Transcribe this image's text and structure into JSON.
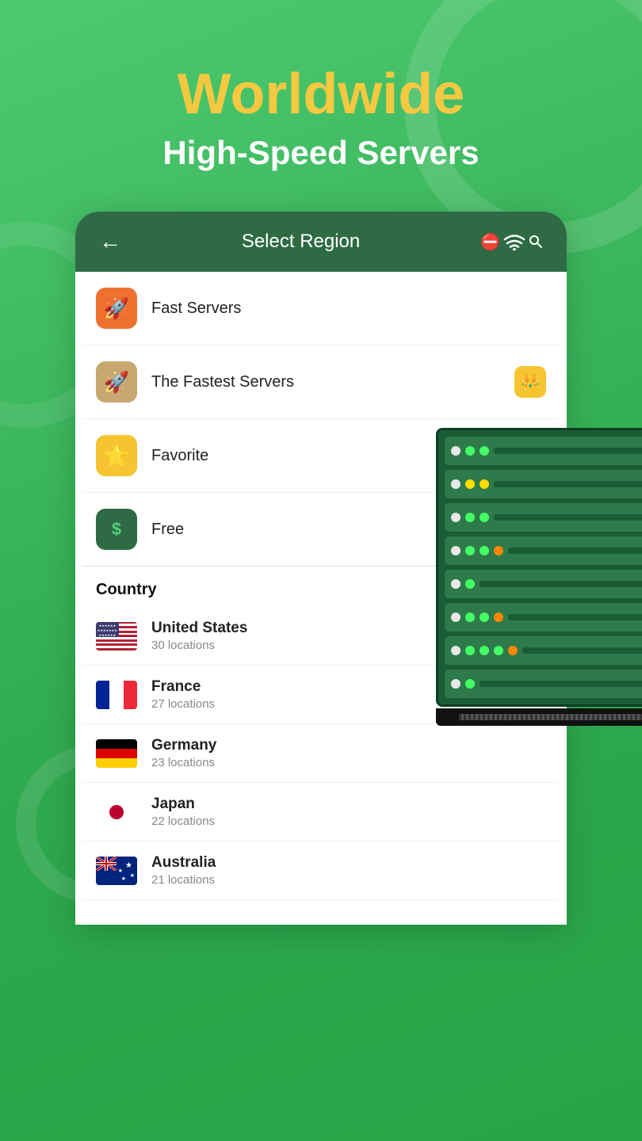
{
  "header": {
    "title_line1": "Worldwide",
    "title_line2": "High-Speed Servers"
  },
  "card": {
    "back_arrow": "←",
    "title": "Select Region",
    "wifi_icon": "📡"
  },
  "menu_items": [
    {
      "id": "fast-servers",
      "label": "Fast Servers",
      "icon": "🚀",
      "icon_bg": "orange",
      "right": ""
    },
    {
      "id": "fastest-servers",
      "label": "The Fastest Servers",
      "icon": "🚀",
      "icon_bg": "tan",
      "right": "crown"
    },
    {
      "id": "favorite",
      "label": "Favorite",
      "icon": "⭐",
      "icon_bg": "yellow",
      "right": "chevron"
    },
    {
      "id": "free",
      "label": "Free",
      "icon": "$",
      "icon_bg": "green-dark",
      "right": "chevron"
    }
  ],
  "country_section_label": "Country",
  "countries": [
    {
      "code": "us",
      "name": "United States",
      "locations": "30 locations"
    },
    {
      "code": "fr",
      "name": "France",
      "locations": "27 locations"
    },
    {
      "code": "de",
      "name": "Germany",
      "locations": "23 locations"
    },
    {
      "code": "jp",
      "name": "Japan",
      "locations": "22 locations"
    },
    {
      "code": "au",
      "name": "Australia",
      "locations": "21 locations"
    }
  ],
  "rack_rows": [
    {
      "leds": [
        "white",
        "green",
        "green"
      ],
      "bar": true
    },
    {
      "leds": [
        "white",
        "yellow",
        "yellow"
      ],
      "bar": true
    },
    {
      "leds": [
        "white",
        "green",
        "green"
      ],
      "bar": true
    },
    {
      "leds": [
        "white",
        "green",
        "green",
        "orange"
      ],
      "bar": true
    },
    {
      "leds": [
        "white",
        "green"
      ],
      "bar": true
    },
    {
      "leds": [
        "white",
        "green",
        "green",
        "orange"
      ],
      "bar": true
    },
    {
      "leds": [
        "white",
        "green",
        "green",
        "green",
        "orange"
      ],
      "bar": true
    },
    {
      "leds": [
        "white",
        "green"
      ],
      "bar": true
    }
  ]
}
